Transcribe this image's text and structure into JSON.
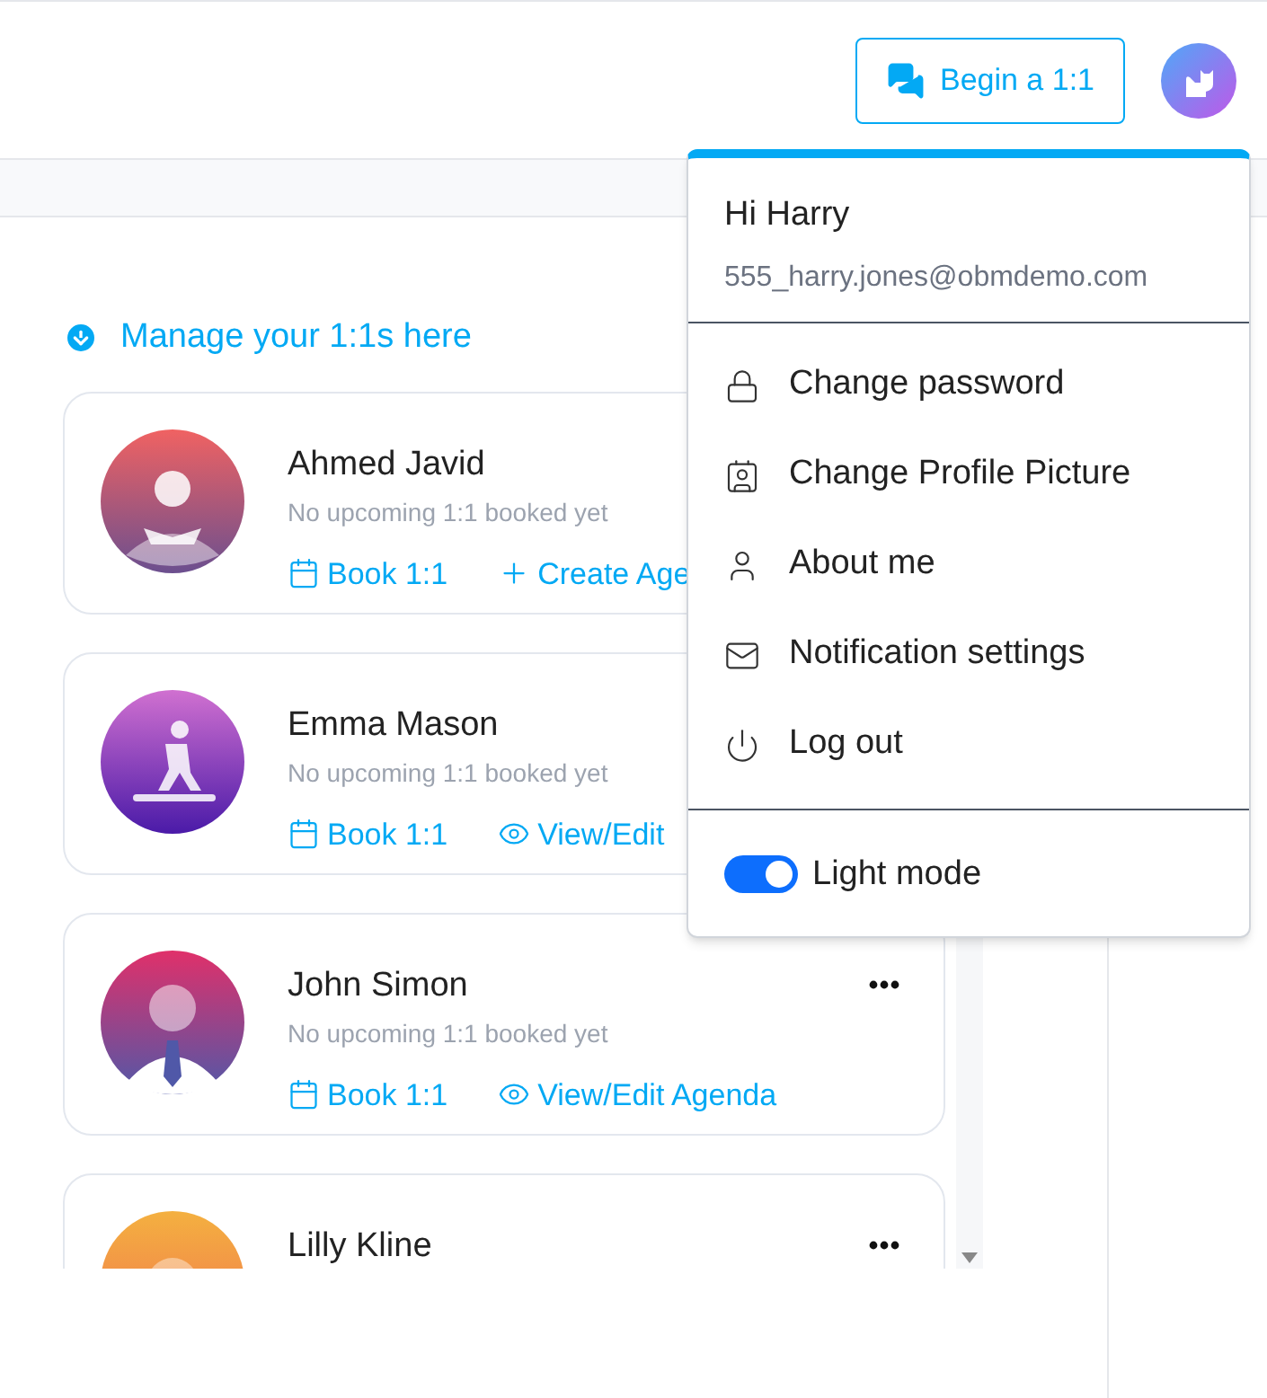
{
  "header": {
    "begin_button": "Begin a 1:1"
  },
  "section": {
    "title": "Manage your 1:1s here"
  },
  "people": [
    {
      "name": "Ahmed Javid",
      "status": "No upcoming 1:1 booked yet",
      "actions": [
        {
          "kind": "book",
          "label": "Book 1:1"
        },
        {
          "kind": "create",
          "label": "Create Age"
        }
      ]
    },
    {
      "name": "Emma Mason",
      "status": "No upcoming 1:1 booked yet",
      "actions": [
        {
          "kind": "book",
          "label": "Book 1:1"
        },
        {
          "kind": "view",
          "label": "View/Edit"
        }
      ]
    },
    {
      "name": "John Simon",
      "status": "No upcoming 1:1 booked yet",
      "menu": true,
      "actions": [
        {
          "kind": "book",
          "label": "Book 1:1"
        },
        {
          "kind": "view",
          "label": "View/Edit Agenda"
        }
      ]
    },
    {
      "name": "Lilly Kline",
      "menu": true
    }
  ],
  "account_menu": {
    "greeting": "Hi Harry",
    "email": "555_harry.jones@obmdemo.com",
    "items": [
      {
        "kind": "lock",
        "label": "Change password"
      },
      {
        "kind": "badge",
        "label": "Change Profile Picture"
      },
      {
        "kind": "user",
        "label": "About me"
      },
      {
        "kind": "mail",
        "label": "Notification settings"
      },
      {
        "kind": "power",
        "label": "Log out"
      }
    ],
    "light_mode": {
      "label": "Light mode",
      "on": true
    }
  }
}
